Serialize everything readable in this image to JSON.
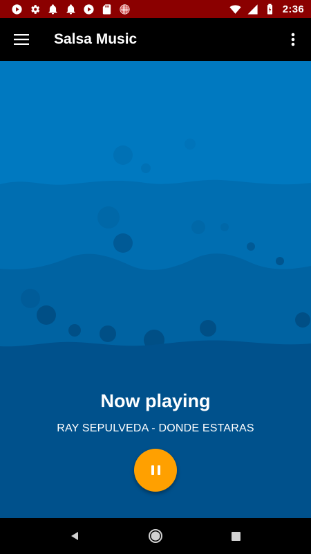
{
  "status_bar": {
    "time": "2:36",
    "background": "#8b0000",
    "left_icons": [
      "play-circle-icon",
      "gear-icon",
      "bell-icon",
      "bell-icon",
      "play-circle-icon",
      "sd-card-icon",
      "radio-icon"
    ],
    "right_icons": [
      "wifi-icon",
      "signal-icon",
      "battery-icon"
    ]
  },
  "app_bar": {
    "title": "Salsa Music",
    "menu_icon": "hamburger-menu-icon",
    "overflow_icon": "more-vert-icon"
  },
  "player": {
    "heading": "Now playing",
    "track": "RAY SEPULVEDA - DONDE ESTARAS",
    "control_icon": "pause-icon",
    "control_color": "#ffa000"
  },
  "colors": {
    "sea_top": "#0077be",
    "sea_mid": "#006cb0",
    "sea_deep": "#005e9e",
    "sea_bottom": "#004f8a"
  },
  "nav_bar": {
    "buttons": [
      "back-icon",
      "home-icon",
      "recents-icon"
    ]
  }
}
